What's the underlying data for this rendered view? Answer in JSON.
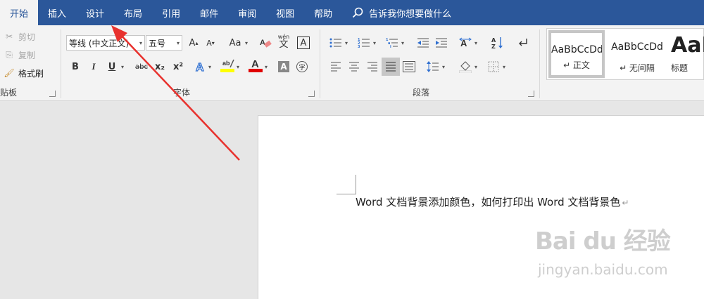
{
  "tabs": [
    {
      "label": "开始",
      "active": true
    },
    {
      "label": "插入"
    },
    {
      "label": "设计"
    },
    {
      "label": "布局"
    },
    {
      "label": "引用"
    },
    {
      "label": "邮件"
    },
    {
      "label": "审阅"
    },
    {
      "label": "视图"
    },
    {
      "label": "帮助"
    }
  ],
  "tell_me": "告诉我你想要做什么",
  "clipboard": {
    "cut": "剪切",
    "copy": "复制",
    "format_painter": "格式刷",
    "label": "贴板"
  },
  "font": {
    "font_name": "等线 (中文正文)",
    "font_size": "五号",
    "grow": "A",
    "shrink": "A",
    "change_case": "Aa",
    "phonetic": "wén",
    "bold": "B",
    "italic": "I",
    "underline": "U",
    "strike": "abc",
    "subscript": "x₂",
    "superscript": "x²",
    "label": "字体"
  },
  "paragraph": {
    "label": "段落"
  },
  "styles": {
    "items": [
      {
        "sample": "AaBbCcDd",
        "name": "↵ 正文",
        "selected": true
      },
      {
        "sample": "AaBbCcDd",
        "name": "↵ 无间隔"
      },
      {
        "sample": "AaB",
        "name": "标题"
      }
    ]
  },
  "document": {
    "text": "Word 文档背景添加颜色，如何打印出 Word 文档背景色",
    "para_mark": "↵"
  },
  "watermark": {
    "logo": "Bai du 经验",
    "url": "jingyan.baidu.com"
  },
  "colors": {
    "ribbon_blue": "#2b579a",
    "highlight": "#ffff00",
    "font_color": "#e00000",
    "arrow": "#e8322e"
  }
}
